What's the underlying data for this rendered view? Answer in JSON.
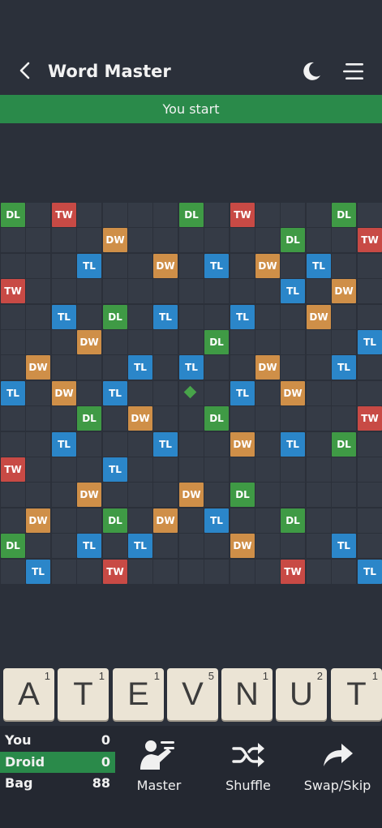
{
  "header": {
    "title": "Word Master",
    "back_icon": "chevron-left-icon",
    "theme_icon": "moon-icon",
    "menu_icon": "hamburger-menu-icon"
  },
  "banner": {
    "text": "You start"
  },
  "colors": {
    "banner": "#2a8a4a",
    "DL": "#3f9a45",
    "TL": "#2b86c9",
    "DW": "#cf8f48",
    "TW": "#c84a45",
    "board_cell": "#353b46",
    "tile": "#ebe4d5"
  },
  "board": {
    "size": 15,
    "rows": [
      [
        "DL",
        "",
        "TW",
        "",
        "",
        "",
        "",
        "DL",
        "",
        "TW",
        "",
        "",
        "",
        "DL",
        ""
      ],
      [
        "",
        "",
        "",
        "",
        "DW",
        "",
        "",
        "",
        "",
        "",
        "",
        "DL",
        "",
        "",
        "TW"
      ],
      [
        "",
        "",
        "",
        "TL",
        "",
        "",
        "DW",
        "",
        "TL",
        "",
        "DW",
        "",
        "TL",
        "",
        ""
      ],
      [
        "TW",
        "",
        "",
        "",
        "",
        "",
        "",
        "",
        "",
        "",
        "",
        "TL",
        "",
        "DW",
        ""
      ],
      [
        "",
        "",
        "TL",
        "",
        "DL",
        "",
        "TL",
        "",
        "",
        "TL",
        "",
        "",
        "DW",
        "",
        ""
      ],
      [
        "",
        "",
        "",
        "DW",
        "",
        "",
        "",
        "",
        "DL",
        "",
        "",
        "",
        "",
        "",
        "TL"
      ],
      [
        "",
        "DW",
        "",
        "",
        "",
        "TL",
        "",
        "TL",
        "",
        "",
        "DW",
        "",
        "",
        "TL",
        ""
      ],
      [
        "TL",
        "",
        "DW",
        "",
        "TL",
        "",
        "",
        "*",
        "",
        "TL",
        "",
        "DW",
        "",
        "",
        ""
      ],
      [
        "",
        "",
        "",
        "DL",
        "",
        "DW",
        "",
        "",
        "DL",
        "",
        "",
        "",
        "",
        "",
        "TW"
      ],
      [
        "",
        "",
        "TL",
        "",
        "",
        "",
        "TL",
        "",
        "",
        "DW",
        "",
        "TL",
        "",
        "DL",
        ""
      ],
      [
        "TW",
        "",
        "",
        "",
        "TL",
        "",
        "",
        "",
        "",
        "",
        "",
        "",
        "",
        "",
        ""
      ],
      [
        "",
        "",
        "",
        "DW",
        "",
        "",
        "",
        "DW",
        "",
        "DL",
        "",
        "",
        "",
        "",
        ""
      ],
      [
        "",
        "DW",
        "",
        "",
        "DL",
        "",
        "DW",
        "",
        "TL",
        "",
        "",
        "DL",
        "",
        "",
        ""
      ],
      [
        "DL",
        "",
        "",
        "TL",
        "",
        "TL",
        "",
        "",
        "",
        "DW",
        "",
        "",
        "",
        "TL",
        ""
      ],
      [
        "",
        "TL",
        "",
        "",
        "TW",
        "",
        "",
        "",
        "",
        "",
        "",
        "TW",
        "",
        "",
        "TL"
      ]
    ]
  },
  "rack": [
    {
      "letter": "A",
      "points": "1"
    },
    {
      "letter": "T",
      "points": "1"
    },
    {
      "letter": "E",
      "points": "1"
    },
    {
      "letter": "V",
      "points": "5"
    },
    {
      "letter": "N",
      "points": "1"
    },
    {
      "letter": "U",
      "points": "2"
    },
    {
      "letter": "T",
      "points": "1"
    }
  ],
  "scores": [
    {
      "label": "You",
      "value": "0",
      "active": false
    },
    {
      "label": "Droid",
      "value": "0",
      "active": true
    },
    {
      "label": "Bag",
      "value": "88",
      "active": false
    }
  ],
  "actions": [
    {
      "label": "Master",
      "icon": "master-icon"
    },
    {
      "label": "Shuffle",
      "icon": "shuffle-icon"
    },
    {
      "label": "Swap/Skip",
      "icon": "share-arrow-icon"
    }
  ]
}
